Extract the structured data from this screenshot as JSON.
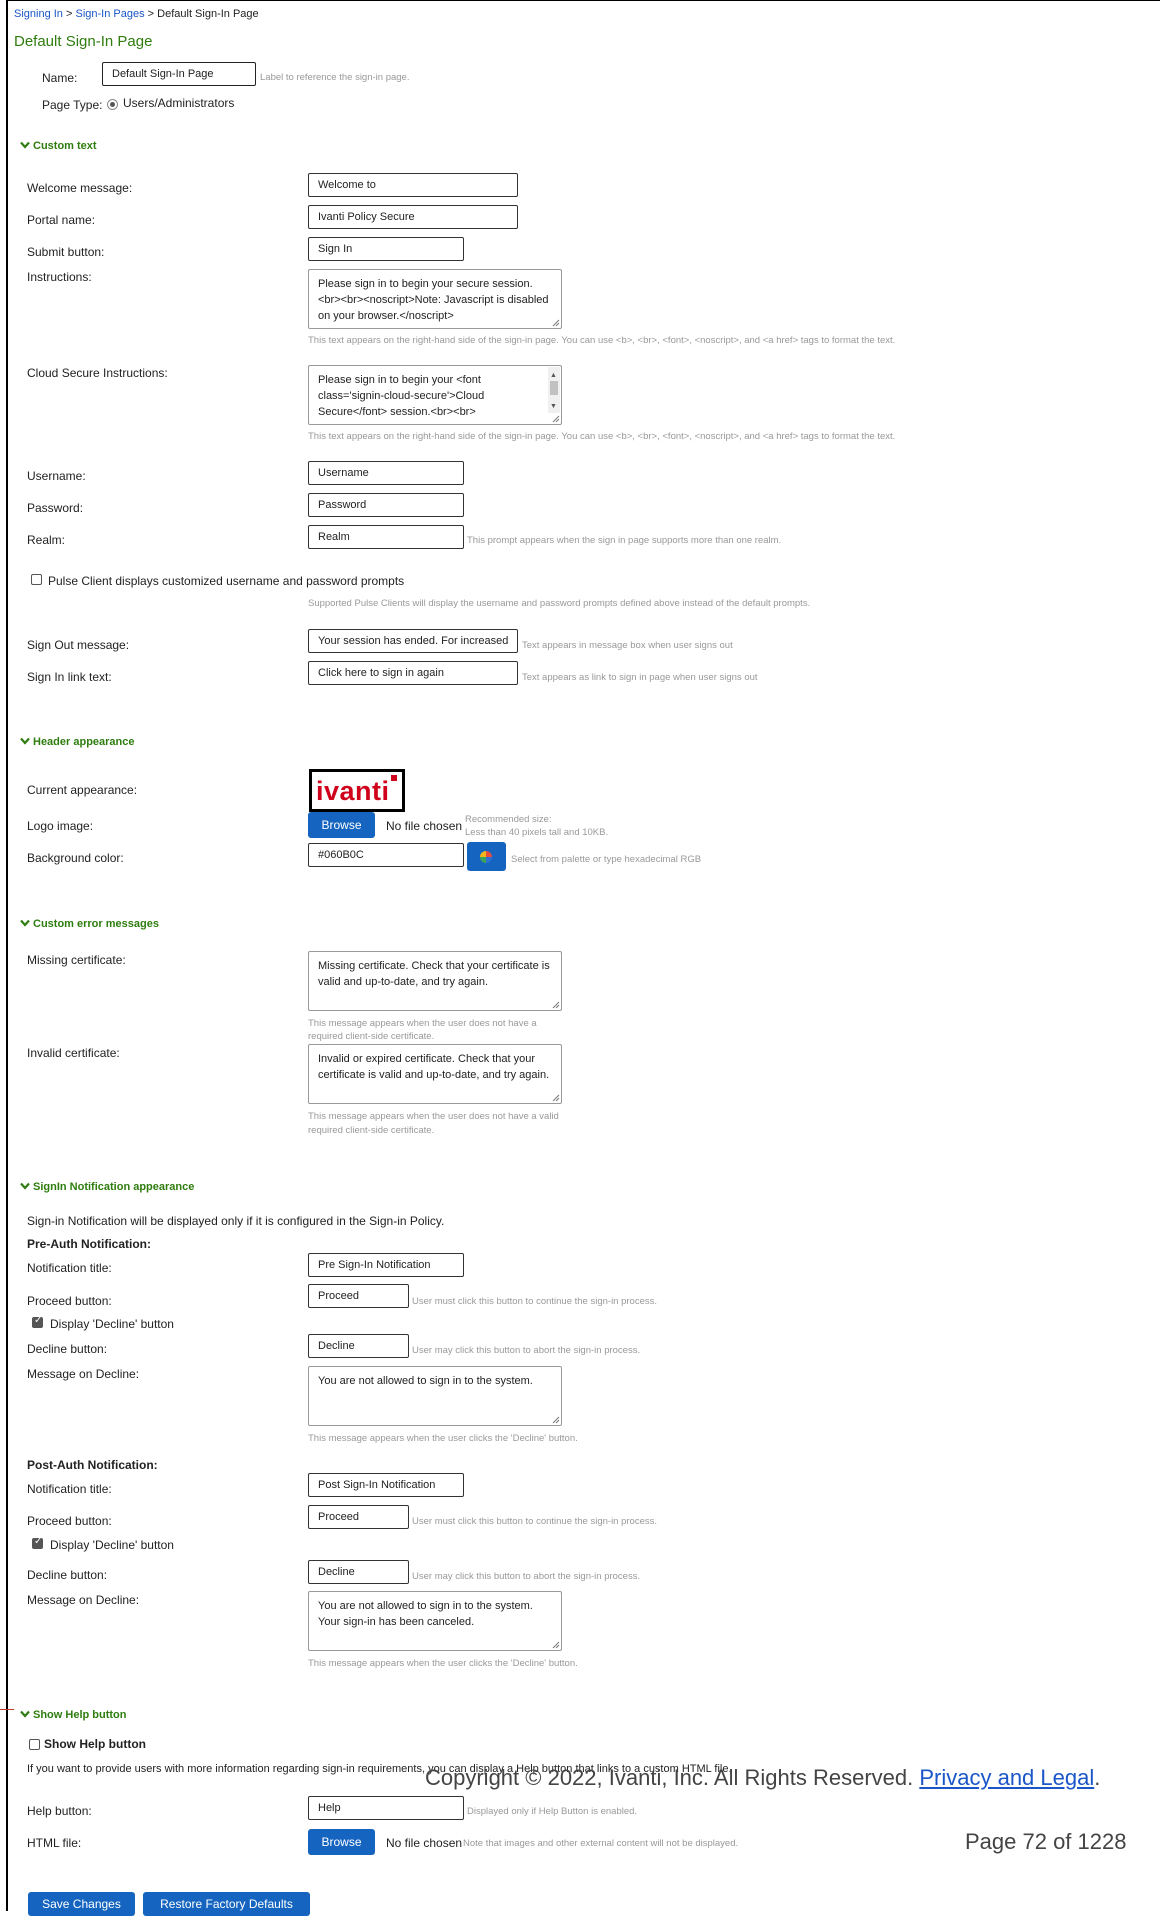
{
  "breadcrumb": {
    "signing_in": "Signing In",
    "sep1": " > ",
    "signin_pages": "Sign-In Pages",
    "sep2": " > ",
    "current": "Default Sign-In Page"
  },
  "page_title": "Default Sign-In Page",
  "name_label": "Name:",
  "name_value": "Default Sign-In Page",
  "name_help": "Label to reference the sign-in page.",
  "page_type_label": "Page Type:",
  "page_type_value": "Users/Administrators",
  "custom_text": {
    "title": "Custom text",
    "welcome_label": "Welcome message:",
    "welcome_value": "Welcome to",
    "portal_label": "Portal name:",
    "portal_value": "Ivanti Policy Secure",
    "submit_label": "Submit button:",
    "submit_value": "Sign In",
    "instructions_label": "Instructions:",
    "instructions_lines": [
      "Please sign in to begin your secure session.",
      "<br><br><noscript>Note: Javascript is disabled",
      "on your browser.</noscript>"
    ],
    "instructions_help": "This text appears on the right-hand side of the sign-in page. You can use <b>, <br>, <font>, <noscript>, and <a href> tags to format the text.",
    "cloud_label": "Cloud Secure Instructions:",
    "cloud_lines": [
      "Please sign in to begin your <font",
      "class='signin-cloud-secure'>Cloud",
      "Secure</font> session.<br><br>"
    ],
    "cloud_help": "This text appears on the right-hand side of the sign-in page. You can use <b>, <br>, <font>, <noscript>, and <a href> tags to format the text.",
    "username_label": "Username:",
    "username_value": "Username",
    "password_label": "Password:",
    "password_value": "Password",
    "realm_label": "Realm:",
    "realm_value": "Realm",
    "realm_help": "This prompt appears when the sign in page supports more than one realm.",
    "pulse_label": "Pulse Client displays customized username and password prompts",
    "pulse_help": "Supported Pulse Clients will display the username and password prompts defined above instead of the default prompts.",
    "signout_label": "Sign Out message:",
    "signout_value": "Your session has ended. For increased",
    "signout_help": "Text appears in message box when user signs out",
    "signin_link_label": "Sign In link text:",
    "signin_link_value": "Click here to sign in again",
    "signin_link_help": "Text appears as link to sign in page when user signs out"
  },
  "header_appearance": {
    "title": "Header appearance",
    "current_label": "Current appearance:",
    "logo_text": "ivanti",
    "logo_label": "Logo image:",
    "browse": "Browse",
    "no_file": "No file chosen",
    "logo_help_1": "Recommended size:",
    "logo_help_2": "Less than 40 pixels tall and 10KB.",
    "bg_label": "Background color:",
    "bg_value": "#060B0C",
    "bg_help": "Select from palette or type hexadecimal RGB"
  },
  "error_messages": {
    "title": "Custom error messages",
    "missing_label": "Missing certificate:",
    "missing_lines": [
      "Missing certificate. Check that your certificate is",
      "valid and up-to-date, and try again."
    ],
    "missing_help_1": "This message appears when the user does not have a",
    "missing_help_2": "required client-side certificate.",
    "invalid_label": "Invalid certificate:",
    "invalid_lines": [
      "Invalid or expired certificate. Check that your",
      "certificate is valid and up-to-date, and try again."
    ],
    "invalid_help_1": "This message appears when the user does not have a valid",
    "invalid_help_2": "required client-side certificate."
  },
  "notification": {
    "title": "SignIn Notification appearance",
    "intro": "Sign-in Notification will be displayed only if it is configured in the Sign-in Policy.",
    "pre_heading": "Pre-Auth Notification:",
    "post_heading": "Post-Auth Notification:",
    "notif_title_label": "Notification title:",
    "pre_title_value": "Pre Sign-In Notification",
    "post_title_value": "Post Sign-In Notification",
    "proceed_label": "Proceed button:",
    "proceed_value": "Proceed",
    "proceed_help": "User must click this button to continue the sign-in process.",
    "display_decline": "Display 'Decline' button",
    "decline_label": "Decline button:",
    "decline_value": "Decline",
    "decline_help": "User may click this button to abort the sign-in process.",
    "msg_decline_label": "Message on Decline:",
    "pre_msg_lines": [
      "You are not allowed to sign in to the system."
    ],
    "post_msg_lines": [
      "You are not allowed to sign in to the system.",
      "Your sign-in has been canceled."
    ],
    "msg_help": "This message appears when the user clicks the 'Decline' button."
  },
  "help_button": {
    "title": "Show Help button",
    "checkbox": "Show Help button",
    "intro": "If you want to provide users with more information regarding sign-in requirements, you can display a Help button that links to a custom HTML file.",
    "help_label": "Help button:",
    "help_value": "Help",
    "help_help": "Displayed only if Help Button is enabled.",
    "html_label": "HTML file:",
    "browse": "Browse",
    "no_file": "No file chosen",
    "html_help": "Note that images and other external content will not be displayed."
  },
  "actions": {
    "save": "Save Changes",
    "restore": "Restore Factory Defaults"
  },
  "footer": {
    "copyright": "Copyright © 2022, Ivanti, Inc. All Rights Reserved. ",
    "privacy": "Privacy and Legal",
    "period": ".",
    "page": "Page 72 of 1228"
  },
  "colors": {
    "section": "#2e7d0e",
    "button": "#1565c0",
    "logo_red": "#d0021b",
    "link": "#1a56c8"
  }
}
